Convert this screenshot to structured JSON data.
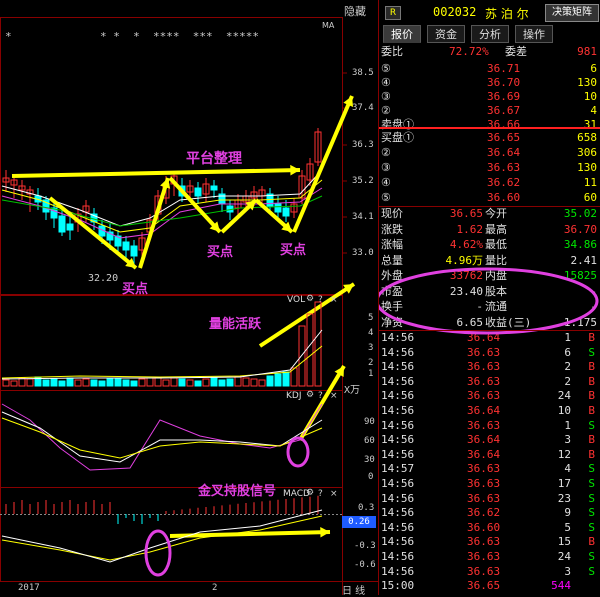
{
  "colors": {
    "up": "#ff3232",
    "down": "#00ffff",
    "ma_yellow": "#ffff00",
    "ma_white": "#ffffff",
    "annot": "#e040e0",
    "arrow": "#ffff00"
  },
  "chart": {
    "hide_label": "隐藏",
    "stars_left": "*",
    "stars_mid": "* *  *  ****  ***  *****",
    "ma_label": "MA",
    "price_ticks": [
      "38.5",
      "37.4",
      "36.3",
      "35.2",
      "34.1",
      "33.0"
    ],
    "low_price_label": "32.20",
    "vol": {
      "label": "VOL",
      "ticks": [
        "5",
        "4",
        "3",
        "2",
        "1"
      ],
      "unit": "X万"
    },
    "kdj": {
      "label": "KDJ",
      "ticks": [
        "90",
        "60",
        "30",
        "0"
      ]
    },
    "macd": {
      "label": "MACD",
      "ticks": [
        "0.3",
        "-0.3",
        "-0.6"
      ],
      "value_badge": "0.26"
    },
    "date_left": "2017",
    "date_mid": "2",
    "bottom_tab": "日 线",
    "annotations": {
      "platform": "平台整理",
      "buy1": "买点",
      "buy2": "买点",
      "buy3": "买点",
      "volume": "量能活跃",
      "golden_cross": "金叉持股信号"
    }
  },
  "quote": {
    "badge": "R",
    "code": "002032",
    "name": "苏 泊 尔",
    "matrix_button": "决策矩阵",
    "tabs": [
      "报价",
      "资金",
      "分析",
      "操作"
    ],
    "weibi_label": "委比",
    "weibi_value": "72.72%",
    "weicha_label": "委差",
    "weicha_value": "981",
    "asks": [
      {
        "label": "⑤",
        "price": "36.71",
        "vol": "6"
      },
      {
        "label": "④",
        "price": "36.70",
        "vol": "130"
      },
      {
        "label": "③",
        "price": "36.69",
        "vol": "10"
      },
      {
        "label": "②",
        "price": "36.67",
        "vol": "4"
      },
      {
        "label": "卖盘①",
        "price": "36.66",
        "vol": "31"
      }
    ],
    "bids": [
      {
        "label": "买盘①",
        "price": "36.65",
        "vol": "658"
      },
      {
        "label": "②",
        "price": "36.64",
        "vol": "306"
      },
      {
        "label": "③",
        "price": "36.63",
        "vol": "130"
      },
      {
        "label": "④",
        "price": "36.62",
        "vol": "11"
      },
      {
        "label": "⑤",
        "price": "36.60",
        "vol": "60"
      }
    ],
    "stats": [
      {
        "l1": "现价",
        "v1": "36.65",
        "c1": "red",
        "l2": "今开",
        "v2": "35.02",
        "c2": "green"
      },
      {
        "l1": "涨跌",
        "v1": "1.62",
        "c1": "red",
        "l2": "最高",
        "v2": "36.70",
        "c2": "red"
      },
      {
        "l1": "涨幅",
        "v1": "4.62%",
        "c1": "red",
        "l2": "最低",
        "v2": "34.86",
        "c2": "green"
      },
      {
        "l1": "总量",
        "v1": "4.96万",
        "c1": "yellow",
        "l2": "量比",
        "v2": "2.41",
        "c2": "white"
      },
      {
        "l1": "外盘",
        "v1": "33762",
        "c1": "red",
        "l2": "内盘",
        "v2": "15825",
        "c2": "green"
      },
      {
        "l1": "市盈",
        "v1": "23.40",
        "c1": "white",
        "l2": "股本",
        "v2": "-",
        "c2": "white"
      },
      {
        "l1": "换手",
        "v1": "-",
        "c1": "white",
        "l2": "流通",
        "v2": "-",
        "c2": "white"
      },
      {
        "l1": "净资",
        "v1": "6.65",
        "c1": "white",
        "l2": "收益(三)",
        "v2": "1.175",
        "c2": "white"
      }
    ],
    "ticks": [
      {
        "time": "14:56",
        "price": "36.64",
        "vol": "1",
        "side": "B"
      },
      {
        "time": "14:56",
        "price": "36.63",
        "vol": "6",
        "side": "S"
      },
      {
        "time": "14:56",
        "price": "36.63",
        "vol": "2",
        "side": "B"
      },
      {
        "time": "14:56",
        "price": "36.63",
        "vol": "2",
        "side": "B"
      },
      {
        "time": "14:56",
        "price": "36.63",
        "vol": "24",
        "side": "B"
      },
      {
        "time": "14:56",
        "price": "36.64",
        "vol": "10",
        "side": "B"
      },
      {
        "time": "14:56",
        "price": "36.63",
        "vol": "1",
        "side": "S"
      },
      {
        "time": "14:56",
        "price": "36.64",
        "vol": "3",
        "side": "B"
      },
      {
        "time": "14:56",
        "price": "36.64",
        "vol": "12",
        "side": "B"
      },
      {
        "time": "14:57",
        "price": "36.63",
        "vol": "4",
        "side": "S"
      },
      {
        "time": "14:56",
        "price": "36.63",
        "vol": "17",
        "side": "S"
      },
      {
        "time": "14:56",
        "price": "36.63",
        "vol": "23",
        "side": "S"
      },
      {
        "time": "14:56",
        "price": "36.62",
        "vol": "9",
        "side": "S"
      },
      {
        "time": "14:56",
        "price": "36.60",
        "vol": "5",
        "side": "S"
      },
      {
        "time": "14:56",
        "price": "36.63",
        "vol": "15",
        "side": "B"
      },
      {
        "time": "14:56",
        "price": "36.63",
        "vol": "24",
        "side": "S"
      },
      {
        "time": "14:56",
        "price": "36.63",
        "vol": "3",
        "side": "S"
      },
      {
        "time": "15:00",
        "price": "36.65",
        "vol": "544",
        "side": ""
      }
    ]
  }
}
